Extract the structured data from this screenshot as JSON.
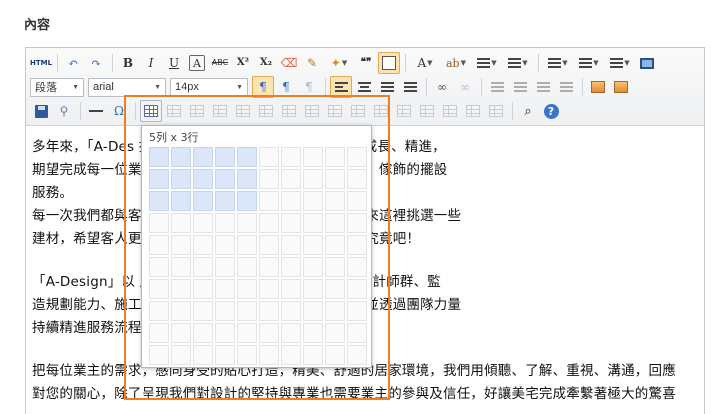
{
  "section_label": "內容",
  "toolbar": {
    "source_label": "HTML",
    "bold_label": "B",
    "italic_label": "I",
    "underline_label": "U",
    "font_color_label": "A",
    "strike_label": "ABC",
    "superscript_label": "X²",
    "subscript_label": "X₂",
    "quote_label": "❝❞",
    "text_color_label": "A",
    "special_char_label": "Ω",
    "help_label": "?",
    "format_select": "段落",
    "font_select": "arial",
    "size_select": "14px"
  },
  "table_picker": {
    "size_label": "5列 x 3行",
    "cols": 10,
    "rows": 10,
    "selected_cols": 5,
    "selected_rows": 3
  },
  "content": {
    "p1": "多年來，「A-Des                                       技的3D預視規劃服務，設計師們不斷成長、精進，",
    "p2": "期望完成每一位業                                       讓、全方位的居家設計、裝修、家俱、傢飾的擺設",
    "p3": "服務。",
    "p4": "每一次我們都與客                                       方所希望完成的夢想家，也會帶客人來這裡挑選一些",
    "p5": "建材，希望客人更                                       籌無法掌握？那麼就直接來這裡一探究竟吧！",
    "p6": "「A-Design」以                                       戶最好的品質保證，聚集經驗豐富的設計師群、監",
    "p7": "造規劃能力、施工                                       新研究、進步前瞻、唯美創新之設計並透過團隊力量",
    "p8": "持續精進服務流程                                       尊」的消費經驗。",
    "p9": "把每位業主的需求，感同身受的貼心打造，精美、舒適的居家環境，我們用傾聽、了解、重視、溝通，回應",
    "p10": "對您的關心，除了呈現我們對設計的堅持與專業也需要業主的參與及信任，好讓美宅完成牽繫著極大的驚喜"
  },
  "colors": {
    "highlight": "#ef7d23",
    "selected_cell": "#dbe6f9",
    "active_button": "#fbe3b2"
  }
}
